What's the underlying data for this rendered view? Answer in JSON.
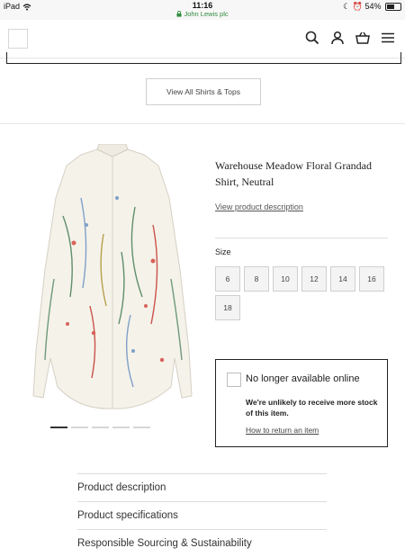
{
  "status_bar": {
    "device": "iPad",
    "time": "11:16",
    "site": "John Lewis plc",
    "battery": "54%",
    "battery_level": 0.54
  },
  "header": {
    "icons": [
      "search-icon",
      "account-icon",
      "basket-icon",
      "menu-icon"
    ]
  },
  "view_all_label": "View All Shirts & Tops",
  "product": {
    "title": "Warehouse Meadow Floral Grandad Shirt, Neutral",
    "view_description_link": "View product description",
    "size_label": "Size",
    "sizes": [
      "6",
      "8",
      "10",
      "12",
      "14",
      "16",
      "18"
    ],
    "image_count": 5,
    "active_image_index": 0
  },
  "availability": {
    "heading": "No longer available online",
    "message": "We're unlikely to receive more stock of this item.",
    "return_link": "How to return an item"
  },
  "accordion": [
    "Product description",
    "Product specifications",
    "Responsible Sourcing & Sustainability"
  ],
  "colors": {
    "accent_green": "#2e8b3d",
    "border": "#222222",
    "size_button_bg": "#f4f4f4"
  }
}
